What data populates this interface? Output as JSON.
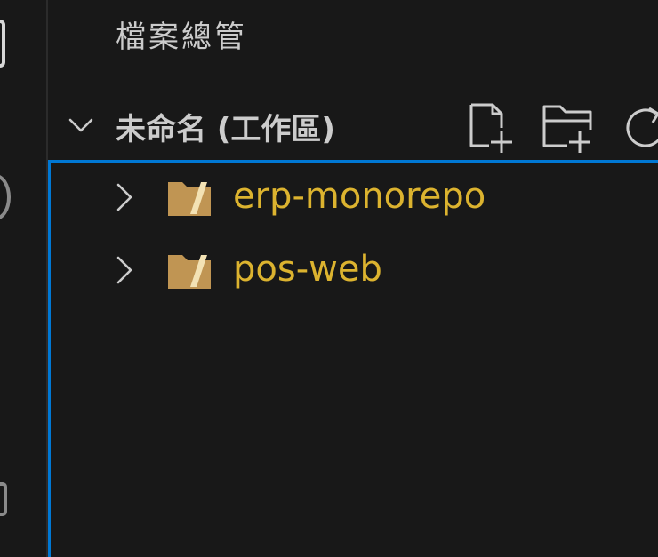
{
  "activity_bar": {
    "icons": [
      "explorer-icon",
      "search-icon",
      "extensions-icon"
    ]
  },
  "explorer": {
    "title": "檔案總管",
    "section": {
      "title": "未命名 (工作區)",
      "expanded": true,
      "actions": [
        {
          "name": "new-file",
          "icon": "new-file-icon"
        },
        {
          "name": "new-folder",
          "icon": "new-folder-icon"
        },
        {
          "name": "refresh",
          "icon": "refresh-icon"
        }
      ]
    },
    "folders": [
      {
        "label": "erp-monorepo",
        "expanded": false
      },
      {
        "label": "pos-web",
        "expanded": false
      }
    ]
  },
  "colors": {
    "background": "#181818",
    "focus_border": "#0078d4",
    "folder_label": "#dcb32f",
    "folder_icon": "#c09553",
    "text": "#cccccc"
  }
}
